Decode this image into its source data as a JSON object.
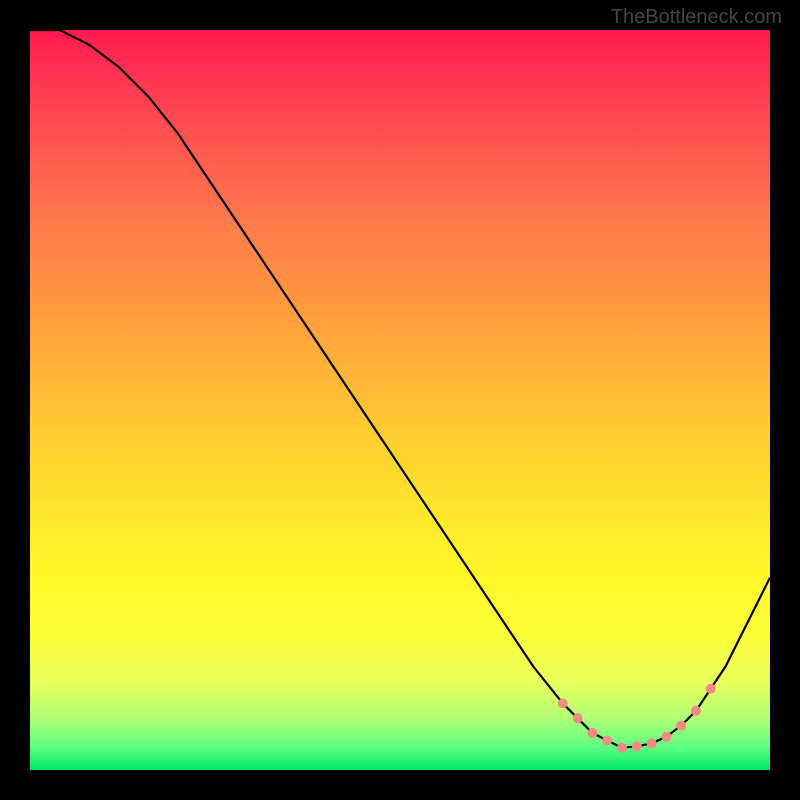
{
  "watermark": "TheBottleneck.com",
  "chart_data": {
    "type": "line",
    "title": "",
    "xlabel": "",
    "ylabel": "",
    "xlim": [
      0,
      100
    ],
    "ylim": [
      0,
      100
    ],
    "series": [
      {
        "name": "curve",
        "x": [
          0,
          4,
          8,
          12,
          16,
          20,
          24,
          28,
          32,
          36,
          40,
          44,
          48,
          52,
          56,
          60,
          64,
          68,
          72,
          74,
          76,
          78,
          80,
          82,
          84,
          86,
          88,
          90,
          92,
          94,
          96,
          98,
          100
        ],
        "values": [
          100,
          100,
          98,
          95,
          91,
          86,
          80,
          74,
          68,
          62,
          56,
          50,
          44,
          38,
          32,
          26,
          20,
          14,
          9,
          7,
          5,
          4,
          3,
          3.2,
          3.6,
          4.5,
          6,
          8,
          11,
          14,
          18,
          22,
          26
        ]
      }
    ],
    "markers": {
      "name": "highlight-dots",
      "color": "#f28b82",
      "x": [
        72,
        74,
        76,
        78,
        80,
        82,
        84,
        86,
        88,
        90,
        92
      ],
      "values": [
        9,
        7,
        5,
        4,
        3,
        3.2,
        3.6,
        4.5,
        6,
        8,
        11
      ]
    },
    "gradient_stops": [
      {
        "pos": 0,
        "color": "#ff1a4d"
      },
      {
        "pos": 16,
        "color": "#ff5850"
      },
      {
        "pos": 36,
        "color": "#ff9640"
      },
      {
        "pos": 56,
        "color": "#ffd030"
      },
      {
        "pos": 74,
        "color": "#fff82a"
      },
      {
        "pos": 93,
        "color": "#b0ff78"
      },
      {
        "pos": 100,
        "color": "#00e865"
      }
    ]
  }
}
